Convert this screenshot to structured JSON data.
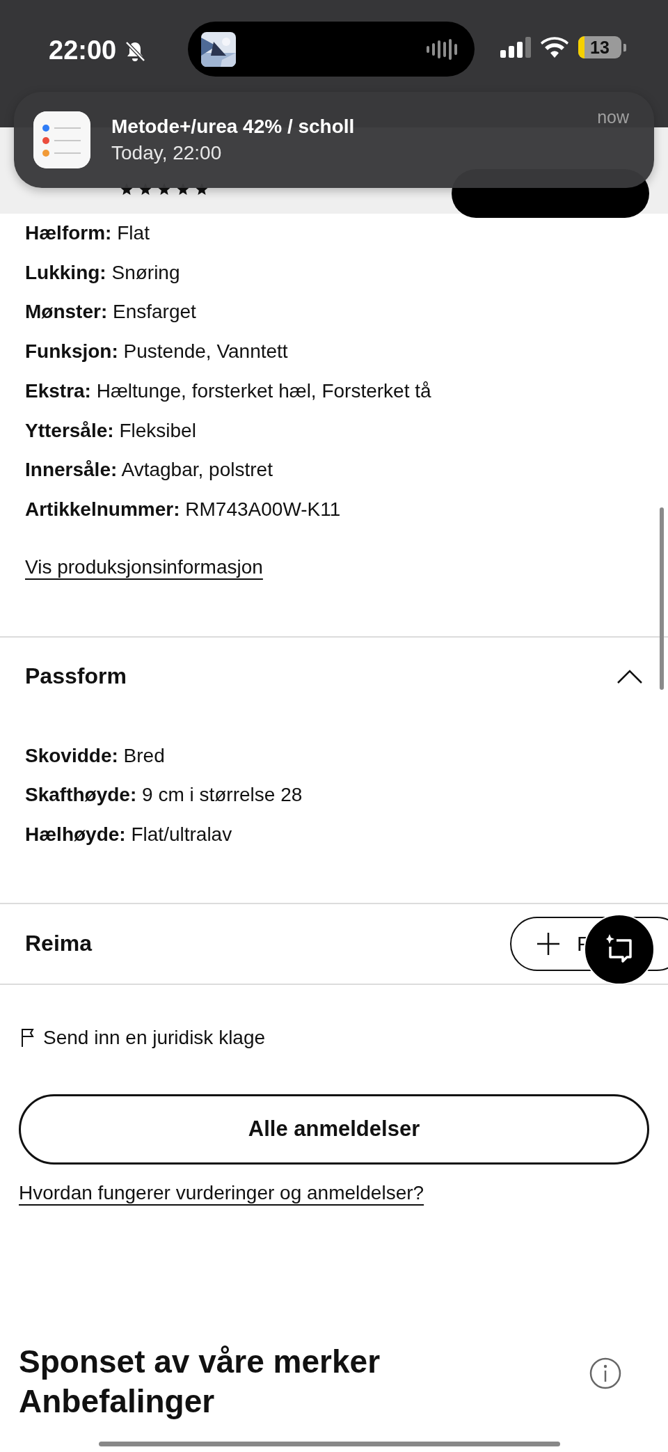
{
  "status_bar": {
    "time": "22:00",
    "battery": "13"
  },
  "notification": {
    "title": "Metode+/urea 42% / scholl",
    "subtitle": "Today, 22:00",
    "time": "now"
  },
  "specs": [
    {
      "text": "**Hælform:** Flat"
    },
    {
      "text": "**Lukking:** Snøring"
    },
    {
      "text": "**Mønster:** Ensfarget"
    },
    {
      "text": "**Funksjon:** Pustende, Vanntett"
    },
    {
      "text": "**Ekstra:** Hæltunge, forsterket hæl, Forsterket tå"
    },
    {
      "text": "**Yttersåle:** Fleksibel"
    },
    {
      "text": "**Innersåle:** Avtagbar, polstret"
    },
    {
      "text": "**Artikkelnummer:** RM743A00W-K11"
    }
  ],
  "production_link": "Vis produksjonsinformasjon",
  "fit_section": {
    "title": "Passform",
    "expanded": true,
    "specs": [
      {
        "text": "**Skovidde:** Bred"
      },
      {
        "text": "**Skafthøyde:** 9 cm i størrelse 28"
      },
      {
        "text": "**Hælhøyde:** Flat/ultralav"
      }
    ]
  },
  "brand": {
    "name": "Reima",
    "follow_button": "F"
  },
  "report_link": "Send inn en juridisk klage",
  "reviews_button": "Alle anmeldelser",
  "reviews_help_link": "Hvordan fungerer vurderinger og anmeldelser?",
  "sponsored": {
    "title": "Sponset av våre merker",
    "subtitle": "Anbefalinger"
  }
}
